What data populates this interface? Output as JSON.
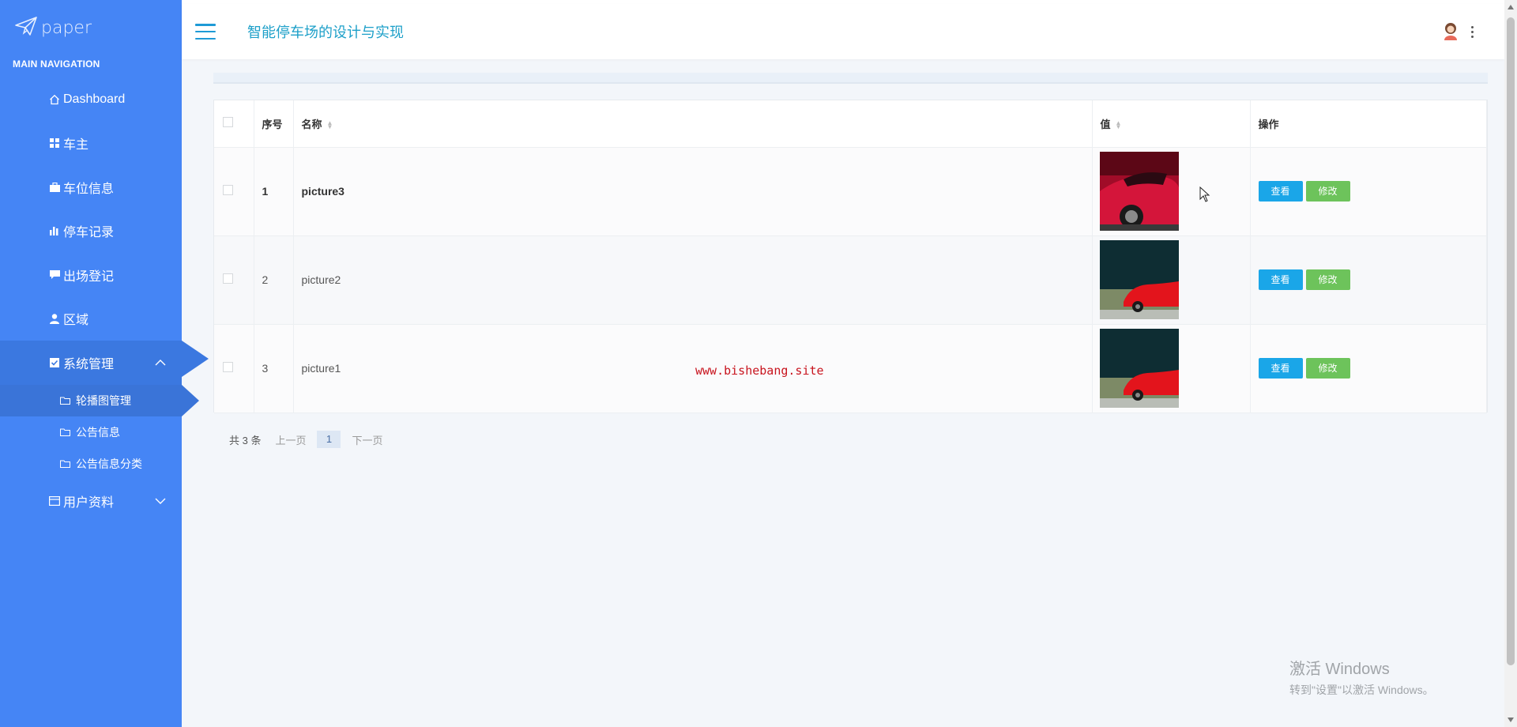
{
  "logo": {
    "text": "paper"
  },
  "sidebar": {
    "header": "MAIN NAVIGATION",
    "items": [
      {
        "label": "Dashboard",
        "icon": "home-icon"
      },
      {
        "label": "车主",
        "icon": "grid-icon"
      },
      {
        "label": "车位信息",
        "icon": "briefcase-icon"
      },
      {
        "label": "停车记录",
        "icon": "bar-chart-icon"
      },
      {
        "label": "出场登记",
        "icon": "comment-icon"
      },
      {
        "label": "区域",
        "icon": "user-icon"
      },
      {
        "label": "系统管理",
        "icon": "checkbox-icon",
        "expanded": true
      },
      {
        "label": "用户资料",
        "icon": "id-card-icon",
        "expanded": false
      }
    ],
    "sub_items": [
      {
        "label": "轮播图管理",
        "icon": "folder-icon",
        "active": true
      },
      {
        "label": "公告信息",
        "icon": "folder-icon"
      },
      {
        "label": "公告信息分类",
        "icon": "folder-icon"
      }
    ]
  },
  "header": {
    "title": "智能停车场的设计与实现"
  },
  "table": {
    "columns": [
      "序号",
      "名称",
      "值",
      "操作"
    ],
    "rows": [
      {
        "index": "1",
        "name": "picture3",
        "view": "查看",
        "edit": "修改"
      },
      {
        "index": "2",
        "name": "picture2",
        "view": "查看",
        "edit": "修改"
      },
      {
        "index": "3",
        "name": "picture1",
        "view": "查看",
        "edit": "修改"
      }
    ]
  },
  "pagination": {
    "total": "共 3 条",
    "prev": "上一页",
    "current": "1",
    "next": "下一页"
  },
  "watermark": "www.bishebang.site",
  "windows_activation": {
    "line1": "激活 Windows",
    "line2": "转到\"设置\"以激活 Windows。"
  },
  "colors": {
    "sidebar": "#4585f5",
    "sidebar_active": "#3b78e0",
    "title": "#1ea0c9",
    "btn_view": "#1aa6e8",
    "btn_edit": "#6dc35b"
  }
}
